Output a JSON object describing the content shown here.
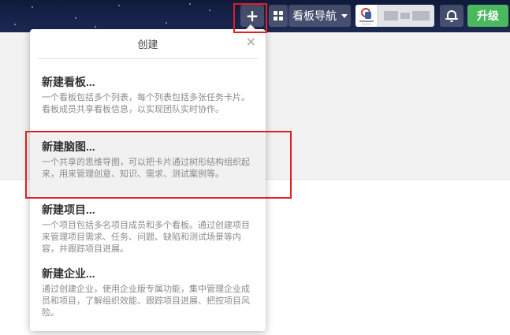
{
  "topbar": {
    "add_button_icon": "plus-icon",
    "add_button_symbol": "+",
    "grid_icon": "grid-icon",
    "board_nav_label": "看板导航",
    "board_nav_caret_icon": "caret-down-icon",
    "user": {
      "avatar_icon": "avatar-logo-icon",
      "name": "[blurred]"
    },
    "bell_icon": "bell-icon",
    "upgrade_label": "升级"
  },
  "colors": {
    "topbar_bg": "#17234a",
    "upgrade_bg": "#4ab85d",
    "annotation_red": "#e01f1f",
    "highlight_bg": "#f1f1f1"
  },
  "popover": {
    "title": "创建",
    "close_symbol": "×",
    "items": [
      {
        "title": "新建看板...",
        "desc": "一个看板包括多个列表，每个列表包括多张任务卡片。看板成员共享看板信息，以实现团队实时协作。",
        "highlighted": false
      },
      {
        "title": "新建脑图...",
        "desc": "一个共享的思维导图，可以把卡片通过树形结构组织起来，用来管理创意、知识、需求、测试案例等。",
        "highlighted": true
      },
      {
        "title": "新建项目...",
        "desc": "一个项目包括多名项目成员和多个看板。通过创建项目来管理项目需求、任务、问题、缺陷和测试场景等内容，并跟踪项目进展。",
        "highlighted": false
      },
      {
        "title": "新建企业...",
        "desc": "通过创建企业，使用企业版专属功能，集中管理企业成员和项目，了解组织效能、跟踪项目进展、把控项目风险。",
        "highlighted": false
      }
    ]
  }
}
